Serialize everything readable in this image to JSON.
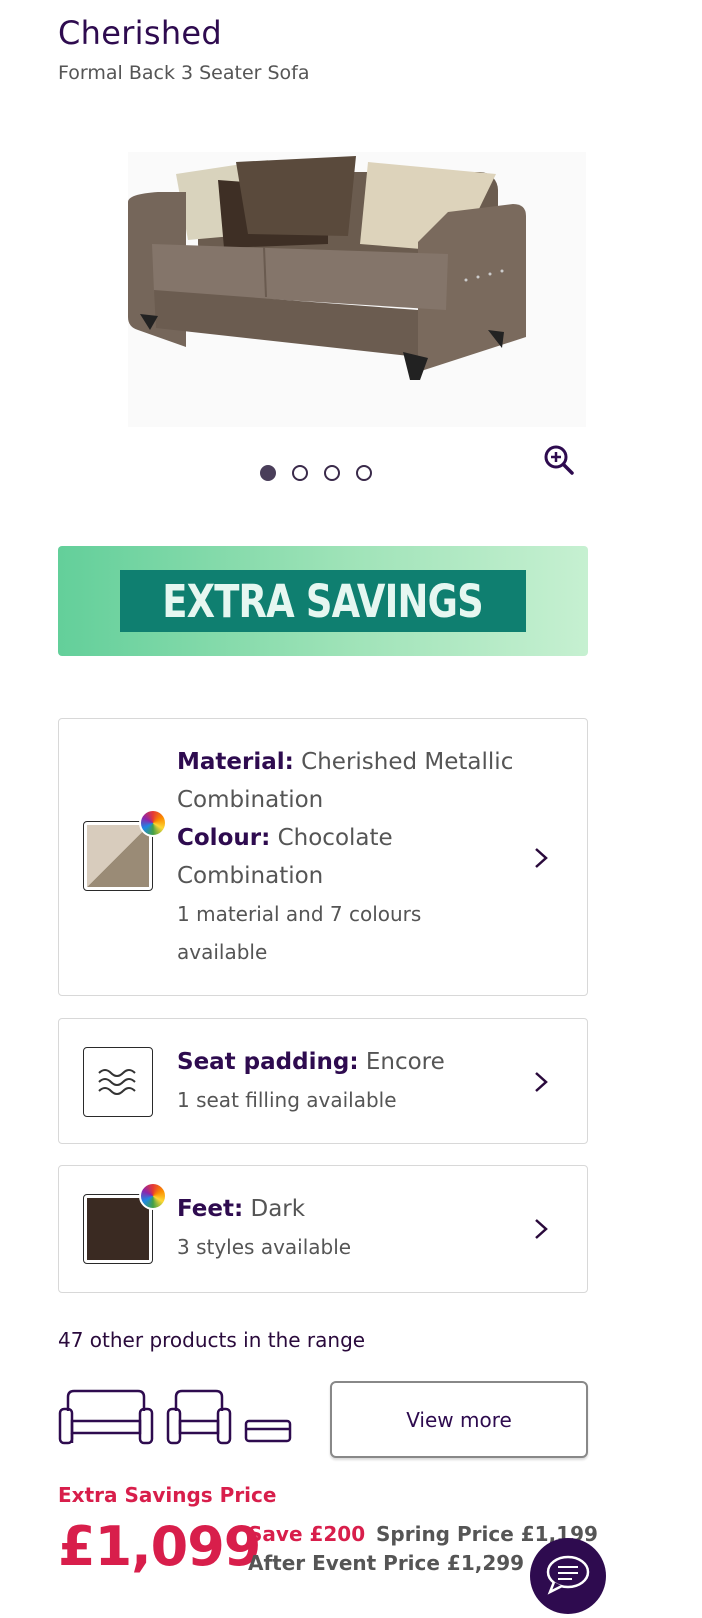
{
  "product": {
    "name": "Cherished",
    "subtitle": "Formal Back 3 Seater Sofa"
  },
  "gallery": {
    "image_count": 4,
    "active_index": 0,
    "zoom_icon": "zoom-in-icon"
  },
  "banner": {
    "text": "EXTRA SAVINGS"
  },
  "options": {
    "material": {
      "label": "Material:",
      "value": "Cherished Metallic Combination",
      "colour_label": "Colour:",
      "colour_value": "Chocolate Combination",
      "availability": "1 material and 7 colours available",
      "swatch_colors": [
        "#d8ccbd",
        "#9a8b76"
      ]
    },
    "seat": {
      "label": "Seat padding:",
      "value": "Encore",
      "availability": "1 seat filling available",
      "icon": "waves-icon"
    },
    "feet": {
      "label": "Feet:",
      "value": "Dark",
      "availability": "3 styles available",
      "swatch_color": "#3a2a22"
    }
  },
  "range": {
    "label": "47 other products in the range",
    "button": "View more",
    "icons": [
      "sofa-icon",
      "chair-icon",
      "footstool-icon"
    ]
  },
  "pricing": {
    "label": "Extra Savings Price",
    "price": "£1,099",
    "save": "Save £200",
    "spring": "Spring Price £1,199",
    "after": "After Event Price £1,299"
  },
  "colors": {
    "brand": "#2e0b4f",
    "sale": "#d81e4b",
    "banner_plate": "#0f7f70"
  }
}
